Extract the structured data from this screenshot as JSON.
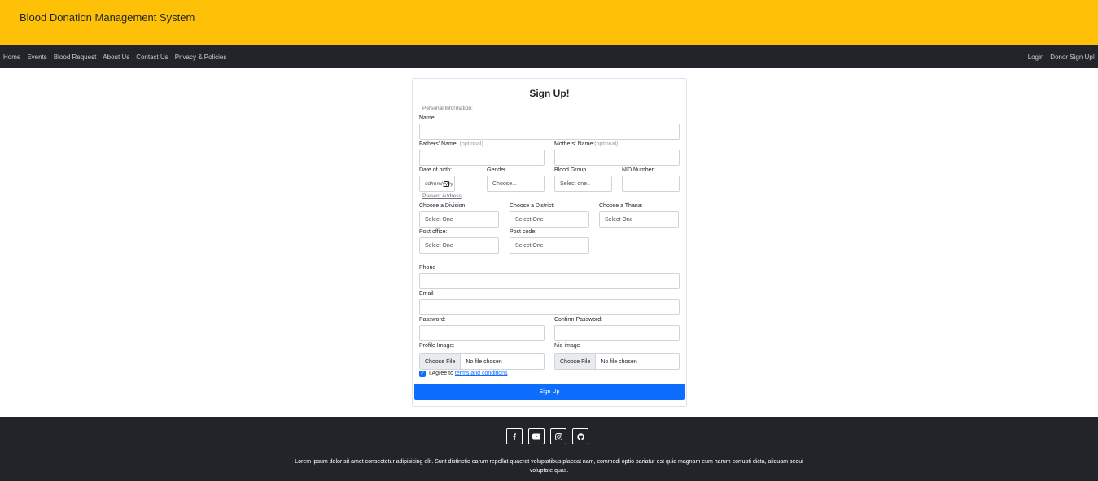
{
  "brand": "Blood Donation Management System",
  "nav": {
    "left": [
      "Home",
      "Events",
      "Blood Request",
      "About Us",
      "Contact Us",
      "Privacy & Policies"
    ],
    "right": [
      "Login",
      "Donor Sign Up!"
    ]
  },
  "form": {
    "title": "Sign Up!",
    "section_personal": "Personal Information:",
    "name_label": "Name",
    "father_label": "Fathers' Name:",
    "father_opt": "(optional)",
    "mother_label": "Mothers' Name:",
    "mother_opt": "(optional)",
    "dob_label": "Date of birth:",
    "dob_placeholder": "dd/mm/yyyy",
    "gender_label": "Gender",
    "gender_value": "Choose...",
    "blood_label": "Blood Group",
    "blood_value": "Select one..",
    "nid_label": "NID Number:",
    "section_address": "Present Address",
    "division_label": "Choose a Division:",
    "division_value": "Select One",
    "district_label": "Choose a District:",
    "district_value": "Select One",
    "thana_label": "Choose a Thana:",
    "thana_value": "Select One",
    "post_office_label": "Post office:",
    "post_office_value": "Select One",
    "post_code_label": "Post code:",
    "post_code_value": "Select One",
    "phone_label": "Phone",
    "email_label": "Email",
    "password_label": "Password:",
    "confirm_label": "Confirm Password:",
    "profile_label": "Profile Image:",
    "nid_image_label": "Nid image",
    "choose_file": "Choose File",
    "no_file": "No file chosen",
    "agree_text": "I Agree to",
    "terms_link": "terms and conditions",
    "submit": "Sign Up"
  },
  "footer": {
    "icons": [
      "facebook-icon",
      "youtube-icon",
      "instagram-icon",
      "github-icon"
    ],
    "text": "Lorem ipsum dolor sit amet consectetur adipisicing elit. Sunt distinctio earum repellat quaerat voluptatibus placeat nam, commodi optio pariatur est quia magnam eum harum corrupti dicta, aliquam sequi voluptate quas."
  },
  "colors": {
    "header": "#ffc107",
    "navbar": "#212529",
    "primary": "#0d6efd"
  }
}
